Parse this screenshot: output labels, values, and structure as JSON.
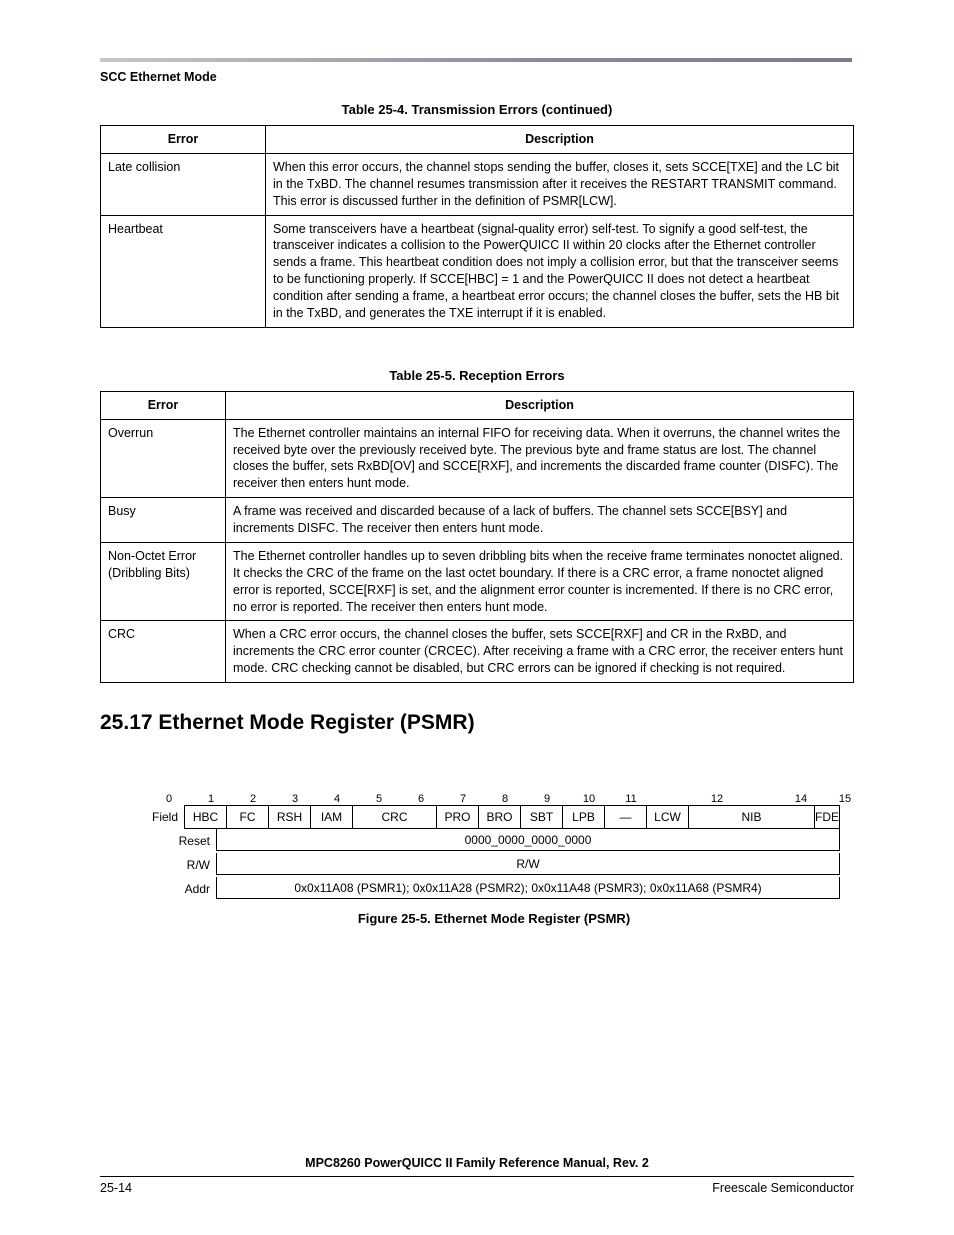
{
  "header": {
    "section": "SCC Ethernet Mode"
  },
  "table1": {
    "caption": "Table 25-4. Transmission Errors (continued)",
    "headers": [
      "Error",
      "Description"
    ],
    "rows": [
      {
        "error": "Late collision",
        "desc": "When this error occurs, the channel stops sending the buffer, closes it, sets SCCE[TXE] and the LC bit in the TxBD. The channel resumes transmission after it receives the RESTART TRANSMIT command. This error is discussed further in the definition of PSMR[LCW]."
      },
      {
        "error": "Heartbeat",
        "desc": "Some transceivers have a heartbeat (signal-quality error) self-test. To signify a good self-test, the transceiver indicates a collision to the PowerQUICC II within 20 clocks after the Ethernet controller sends a frame. This heartbeat condition does not imply a collision error, but that the transceiver seems to be functioning properly. If SCCE[HBC] = 1 and the PowerQUICC II does not detect a heartbeat condition after sending a frame, a heartbeat error occurs; the channel closes the buffer, sets the HB bit in the TxBD, and generates the TXE interrupt if it is enabled."
      }
    ]
  },
  "table2": {
    "caption": "Table 25-5. Reception Errors",
    "headers": [
      "Error",
      "Description"
    ],
    "rows": [
      {
        "error": "Overrun",
        "desc": "The Ethernet controller maintains an internal FIFO for receiving data. When it overruns, the channel writes the received byte over the previously received byte. The previous byte and frame status are lost. The channel closes the buffer, sets RxBD[OV] and SCCE[RXF], and increments the discarded frame counter (DISFC). The receiver then enters hunt mode."
      },
      {
        "error": "Busy",
        "desc": "A frame was received and discarded because of a lack of buffers. The channel sets SCCE[BSY] and increments DISFC. The receiver then enters hunt mode."
      },
      {
        "error": "Non-Octet Error (Dribbling Bits)",
        "desc": "The Ethernet controller handles up to seven dribbling bits when the receive frame terminates nonoctet aligned. It checks the CRC of the frame on the last octet boundary. If there is a CRC error, a frame nonoctet aligned error is reported, SCCE[RXF] is set, and the alignment error counter is incremented. If there is no CRC error, no error is reported. The receiver then enters hunt mode."
      },
      {
        "error": "CRC",
        "desc": "When a CRC error occurs, the channel closes the buffer, sets SCCE[RXF] and CR in the RxBD, and increments the CRC error counter (CRCEC). After receiving a frame with a CRC error, the receiver enters hunt mode. CRC checking cannot be disabled, but CRC errors can be ignored if checking is not required."
      }
    ]
  },
  "heading": "25.17  Ethernet Mode Register (PSMR)",
  "register": {
    "bit_numbers": [
      "0",
      "1",
      "2",
      "3",
      "4",
      "5",
      "6",
      "7",
      "8",
      "9",
      "10",
      "11",
      "12",
      "",
      "14",
      "15"
    ],
    "rowlabels": {
      "field": "Field",
      "reset": "Reset",
      "rw": "R/W",
      "addr": "Addr"
    },
    "fields": [
      "HBC",
      "FC",
      "RSH",
      "IAM",
      "CRC",
      "PRO",
      "BRO",
      "SBT",
      "LPB",
      "—",
      "LCW",
      "NIB",
      "FDE"
    ],
    "reset": "0000_0000_0000_0000",
    "rw": "R/W",
    "addr": "0x0x11A08 (PSMR1); 0x0x11A28 (PSMR2); 0x0x11A48 (PSMR3); 0x0x11A68 (PSMR4)",
    "caption": "Figure 25-5. Ethernet Mode Register (PSMR)"
  },
  "footer": {
    "title": "MPC8260 PowerQUICC II Family Reference Manual, Rev. 2",
    "page": "25-14",
    "company": "Freescale Semiconductor"
  }
}
